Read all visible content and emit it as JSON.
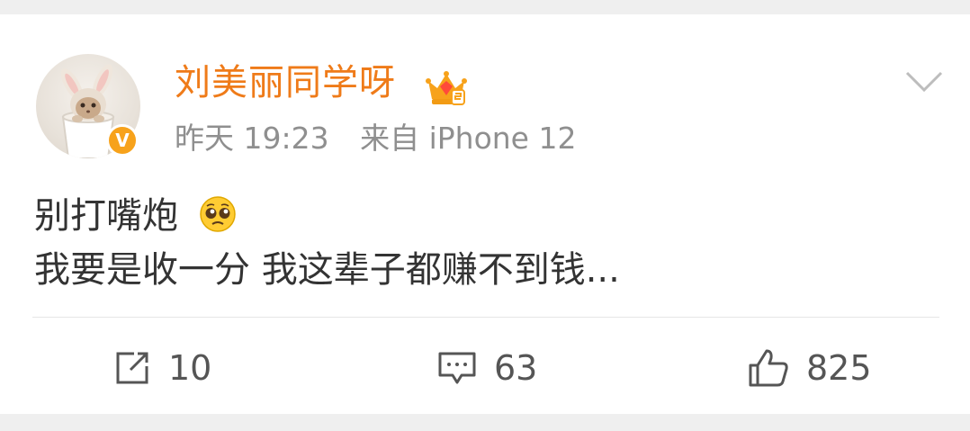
{
  "post": {
    "username": "刘美丽同学呀",
    "time": "昨天 19:23",
    "source": "来自 iPhone 12",
    "text_line1": "别打嘴炮",
    "text_line2": "我要是收一分 我这辈子都赚不到钱...",
    "verified_mark": "V"
  },
  "actions": {
    "share_count": "10",
    "comment_count": "63",
    "like_count": "825"
  },
  "icons": {
    "verified": "verified-v-icon",
    "member": "crown-member-icon",
    "more": "chevron-down-icon",
    "emoji": "pleading-face-icon",
    "share": "share-icon",
    "comment": "comment-icon",
    "like": "thumbs-up-icon"
  },
  "colors": {
    "username": "#ef7b19",
    "meta": "#8f8f8f",
    "badge": "#f7a21b",
    "text": "#333333"
  }
}
